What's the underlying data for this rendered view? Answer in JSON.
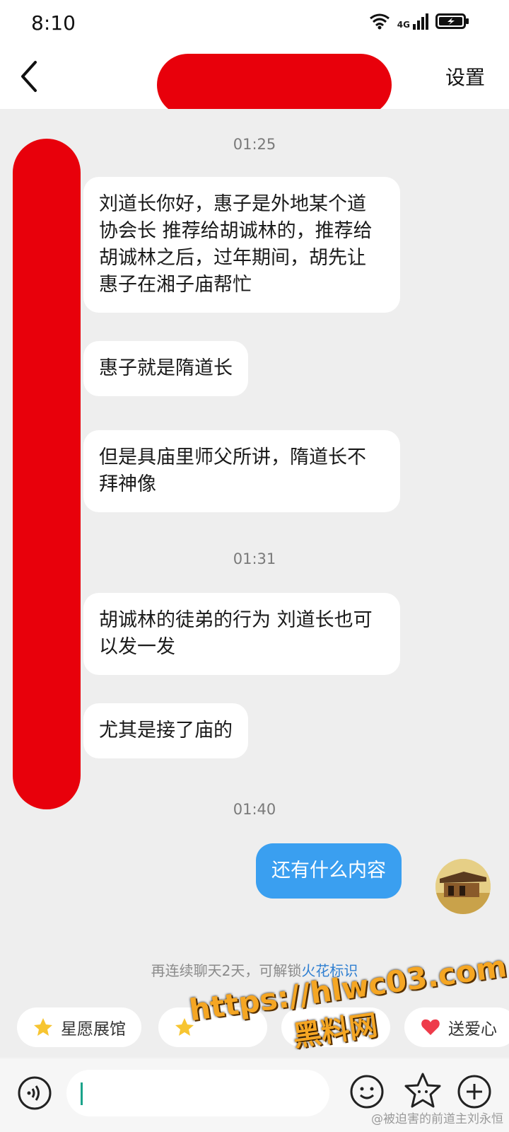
{
  "status_bar": {
    "time": "8:10",
    "network": "4G"
  },
  "header": {
    "settings_label": "设置"
  },
  "messages": [
    {
      "type": "timestamp",
      "text": "01:25"
    },
    {
      "type": "incoming",
      "text": "刘道长你好，惠子是外地某个道协会长 推荐给胡诚林的，推荐给胡诚林之后，过年期间，胡先让惠子在湘子庙帮忙"
    },
    {
      "type": "incoming",
      "text": "惠子就是隋道长"
    },
    {
      "type": "incoming",
      "text": "但是具庙里师父所讲，隋道长不拜神像"
    },
    {
      "type": "timestamp",
      "text": "01:31"
    },
    {
      "type": "incoming",
      "text": "胡诚林的徒弟的行为 刘道长也可以发一发"
    },
    {
      "type": "incoming",
      "text": "尤其是接了庙的"
    },
    {
      "type": "timestamp",
      "text": "01:40"
    },
    {
      "type": "outgoing",
      "text": "还有什么内容"
    }
  ],
  "hint": {
    "prefix": "再连续聊天2天，可解锁",
    "link": "火花标识"
  },
  "quick_actions": [
    {
      "label": "星愿展馆",
      "icon": "star-icon"
    },
    {
      "label": "",
      "icon": "star-icon"
    },
    {
      "label": "",
      "icon": "spark-icon"
    },
    {
      "label": "送爱心",
      "icon": "heart-icon"
    }
  ],
  "watermark": {
    "url": "https://hlwc03.com",
    "name": "黑料网"
  },
  "credit": "@被迫害的前道主刘永恒",
  "colors": {
    "accent_blue": "#3a9ff0",
    "redaction": "#e8000b",
    "link": "#2f7fd1"
  }
}
